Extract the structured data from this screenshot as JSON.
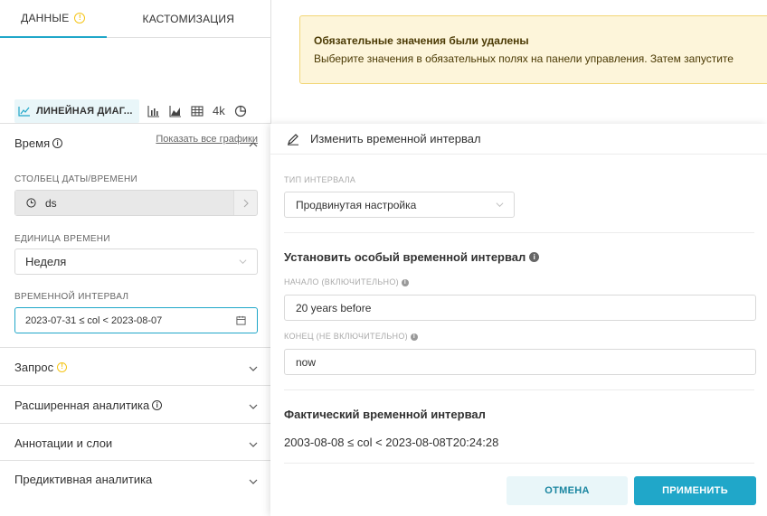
{
  "tabs": {
    "data": "ДАННЫЕ",
    "customize": "КАСТОМИЗАЦИЯ"
  },
  "viz": {
    "selected": "ЛИНЕЙНАЯ ДИАГ...",
    "bignum_label": "4k",
    "show_all": "Показать все графики"
  },
  "time_section": {
    "title": "Время",
    "datetime_col_label": "СТОЛБЕЦ ДАТЫ/ВРЕМЕНИ",
    "datetime_col_value": "ds",
    "grain_label": "ЕДИНИЦА ВРЕМЕНИ",
    "grain_value": "Неделя",
    "range_label": "ВРЕМЕННОЙ ИНТЕРВАЛ",
    "range_value": "2023-07-31 ≤ col < 2023-08-07"
  },
  "sections": {
    "query": "Запрос",
    "advanced": "Расширенная аналитика",
    "annotations": "Аннотации и слои",
    "predictive": "Предиктивная аналитика"
  },
  "alert": {
    "title": "Обязательные значения были удалены",
    "body": "Выберите значения в обязательных полях на панели управления. Затем запустите"
  },
  "popover": {
    "title": "Изменить временной интервал",
    "range_type_label": "ТИП ИНТЕРВАЛА",
    "range_type_value": "Продвинутая настройка",
    "custom_heading": "Установить особый временной интервал",
    "start_label": "НАЧАЛО (ВКЛЮЧИТЕЛЬНО)",
    "start_value": "20 years before",
    "end_label": "КОНЕЦ (НЕ ВКЛЮЧИТЕЛЬНО)",
    "end_value": "now",
    "actual_heading": "Фактический временной интервал",
    "actual_value": "2003-08-08 ≤ col < 2023-08-08T20:24:28",
    "cancel": "ОТМЕНА",
    "apply": "ПРИМЕНИТЬ"
  },
  "colors": {
    "accent": "#20a7c9",
    "warning": "#f5c518",
    "alert_bg": "#fdf5da"
  }
}
